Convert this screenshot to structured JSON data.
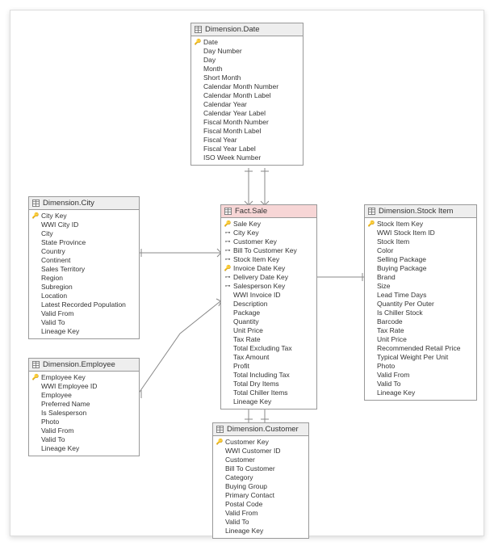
{
  "tables": {
    "date": {
      "title": "Dimension.Date",
      "fields": [
        {
          "label": "Date",
          "icon": "pk"
        },
        {
          "label": "Day Number",
          "icon": ""
        },
        {
          "label": "Day",
          "icon": ""
        },
        {
          "label": "Month",
          "icon": ""
        },
        {
          "label": "Short Month",
          "icon": ""
        },
        {
          "label": "Calendar Month Number",
          "icon": ""
        },
        {
          "label": "Calendar Month Label",
          "icon": ""
        },
        {
          "label": "Calendar Year",
          "icon": ""
        },
        {
          "label": "Calendar Year Label",
          "icon": ""
        },
        {
          "label": "Fiscal Month Number",
          "icon": ""
        },
        {
          "label": "Fiscal Month Label",
          "icon": ""
        },
        {
          "label": "Fiscal Year",
          "icon": ""
        },
        {
          "label": "Fiscal Year Label",
          "icon": ""
        },
        {
          "label": "ISO Week Number",
          "icon": ""
        }
      ]
    },
    "city": {
      "title": "Dimension.City",
      "fields": [
        {
          "label": "City Key",
          "icon": "pk"
        },
        {
          "label": "WWI City ID",
          "icon": ""
        },
        {
          "label": "City",
          "icon": ""
        },
        {
          "label": "State Province",
          "icon": ""
        },
        {
          "label": "Country",
          "icon": ""
        },
        {
          "label": "Continent",
          "icon": ""
        },
        {
          "label": "Sales Territory",
          "icon": ""
        },
        {
          "label": "Region",
          "icon": ""
        },
        {
          "label": "Subregion",
          "icon": ""
        },
        {
          "label": "Location",
          "icon": ""
        },
        {
          "label": "Latest Recorded Population",
          "icon": ""
        },
        {
          "label": "Valid From",
          "icon": ""
        },
        {
          "label": "Valid To",
          "icon": ""
        },
        {
          "label": "Lineage Key",
          "icon": ""
        }
      ]
    },
    "employee": {
      "title": "Dimension.Employee",
      "fields": [
        {
          "label": "Employee Key",
          "icon": "pk"
        },
        {
          "label": "WWI Employee ID",
          "icon": ""
        },
        {
          "label": "Employee",
          "icon": ""
        },
        {
          "label": "Preferred Name",
          "icon": ""
        },
        {
          "label": "Is Salesperson",
          "icon": ""
        },
        {
          "label": "Photo",
          "icon": ""
        },
        {
          "label": "Valid From",
          "icon": ""
        },
        {
          "label": "Valid To",
          "icon": ""
        },
        {
          "label": "Lineage Key",
          "icon": ""
        }
      ]
    },
    "sale": {
      "title": "Fact.Sale",
      "fields": [
        {
          "label": "Sale Key",
          "icon": "pk"
        },
        {
          "label": "City Key",
          "icon": "fk"
        },
        {
          "label": "Customer Key",
          "icon": "fk"
        },
        {
          "label": "Bill To Customer Key",
          "icon": "fk"
        },
        {
          "label": "Stock Item Key",
          "icon": "fk"
        },
        {
          "label": "Invoice Date Key",
          "icon": "pk"
        },
        {
          "label": "Delivery Date Key",
          "icon": "fk"
        },
        {
          "label": "Salesperson Key",
          "icon": "fk"
        },
        {
          "label": "WWI Invoice ID",
          "icon": ""
        },
        {
          "label": "Description",
          "icon": ""
        },
        {
          "label": "Package",
          "icon": ""
        },
        {
          "label": "Quantity",
          "icon": ""
        },
        {
          "label": "Unit Price",
          "icon": ""
        },
        {
          "label": "Tax Rate",
          "icon": ""
        },
        {
          "label": "Total Excluding Tax",
          "icon": ""
        },
        {
          "label": "Tax Amount",
          "icon": ""
        },
        {
          "label": "Profit",
          "icon": ""
        },
        {
          "label": "Total Including Tax",
          "icon": ""
        },
        {
          "label": "Total Dry Items",
          "icon": ""
        },
        {
          "label": "Total Chiller Items",
          "icon": ""
        },
        {
          "label": "Lineage Key",
          "icon": ""
        }
      ]
    },
    "stockitem": {
      "title": "Dimension.Stock Item",
      "fields": [
        {
          "label": "Stock Item Key",
          "icon": "pk"
        },
        {
          "label": "WWI Stock Item ID",
          "icon": ""
        },
        {
          "label": "Stock Item",
          "icon": ""
        },
        {
          "label": "Color",
          "icon": ""
        },
        {
          "label": "Selling Package",
          "icon": ""
        },
        {
          "label": "Buying Package",
          "icon": ""
        },
        {
          "label": "Brand",
          "icon": ""
        },
        {
          "label": "Size",
          "icon": ""
        },
        {
          "label": "Lead Time Days",
          "icon": ""
        },
        {
          "label": "Quantity Per Outer",
          "icon": ""
        },
        {
          "label": "Is Chiller Stock",
          "icon": ""
        },
        {
          "label": "Barcode",
          "icon": ""
        },
        {
          "label": "Tax Rate",
          "icon": ""
        },
        {
          "label": "Unit Price",
          "icon": ""
        },
        {
          "label": "Recommended Retail Price",
          "icon": ""
        },
        {
          "label": "Typical Weight Per Unit",
          "icon": ""
        },
        {
          "label": "Photo",
          "icon": ""
        },
        {
          "label": "Valid From",
          "icon": ""
        },
        {
          "label": "Valid To",
          "icon": ""
        },
        {
          "label": "Lineage Key",
          "icon": ""
        }
      ]
    },
    "customer": {
      "title": "Dimension.Customer",
      "fields": [
        {
          "label": "Customer Key",
          "icon": "pk"
        },
        {
          "label": "WWI Customer ID",
          "icon": ""
        },
        {
          "label": "Customer",
          "icon": ""
        },
        {
          "label": "Bill To Customer",
          "icon": ""
        },
        {
          "label": "Category",
          "icon": ""
        },
        {
          "label": "Buying Group",
          "icon": ""
        },
        {
          "label": "Primary Contact",
          "icon": ""
        },
        {
          "label": "Postal Code",
          "icon": ""
        },
        {
          "label": "Valid From",
          "icon": ""
        },
        {
          "label": "Valid To",
          "icon": ""
        },
        {
          "label": "Lineage Key",
          "icon": ""
        }
      ]
    }
  }
}
